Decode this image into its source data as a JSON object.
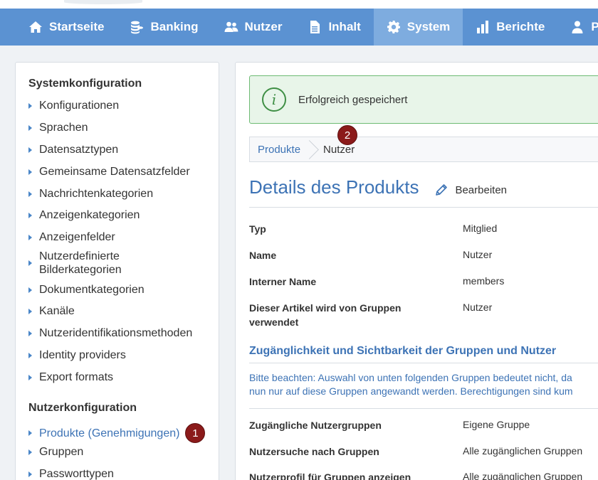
{
  "navbar": {
    "items": [
      {
        "label": "Startseite",
        "icon": "home-icon"
      },
      {
        "label": "Banking",
        "icon": "coins-icon"
      },
      {
        "label": "Nutzer",
        "icon": "users-icon"
      },
      {
        "label": "Inhalt",
        "icon": "document-icon"
      },
      {
        "label": "System",
        "icon": "gear-icon",
        "active": true
      },
      {
        "label": "Berichte",
        "icon": "bar-chart-icon"
      },
      {
        "label": "Pe",
        "icon": "person-icon"
      }
    ]
  },
  "sidebar": {
    "system_heading": "Systemkonfiguration",
    "system_items": [
      "Konfigurationen",
      "Sprachen",
      "Datensatztypen",
      "Gemeinsame Datensatzfelder",
      "Nachrichtenkategorien",
      "Anzeigenkategorien",
      "Anzeigenfelder",
      "Nutzerdefinierte Bilderkategorien",
      "Dokumentkategorien",
      "Kanäle",
      "Nutzeridentifikationsmethoden",
      "Identity providers",
      "Export formats"
    ],
    "user_heading": "Nutzerkonfiguration",
    "user_items": [
      "Produkte (Genehmigungen)",
      "Gruppen",
      "Passworttypen"
    ],
    "badge_1": "1"
  },
  "main": {
    "alert_icon": "info-icon",
    "alert_message": "Erfolgreich gespeichert",
    "breadcrumb": {
      "first": "Produkte",
      "second": "Nutzer",
      "badge_2": "2"
    },
    "title": "Details des Produkts",
    "edit_label": "Bearbeiten",
    "fields": [
      {
        "label": "Typ",
        "value": "Mitglied"
      },
      {
        "label": "Name",
        "value": "Nutzer"
      },
      {
        "label": "Interner Name",
        "value": "members"
      },
      {
        "label": "Dieser Artikel wird von Gruppen verwendet",
        "value": "Nutzer"
      }
    ],
    "section_title": "Zugänglichkeit und Sichtbarkeit der Gruppen und Nutzer",
    "note_line1": "Bitte beachten: Auswahl von unten folgenden Gruppen bedeutet nicht, da",
    "note_line2": "nun nur auf diese Gruppen angewandt werden. Berechtigungen sind kum",
    "access_fields": [
      {
        "label": "Zugängliche Nutzergruppen",
        "value": "Eigene Gruppe"
      },
      {
        "label": "Nutzersuche nach Gruppen",
        "value": "Alle zugänglichen Gruppen"
      },
      {
        "label": "Nutzerprofil für Gruppen anzeigen",
        "value": "Alle zugänglichen Gruppen"
      }
    ]
  }
}
